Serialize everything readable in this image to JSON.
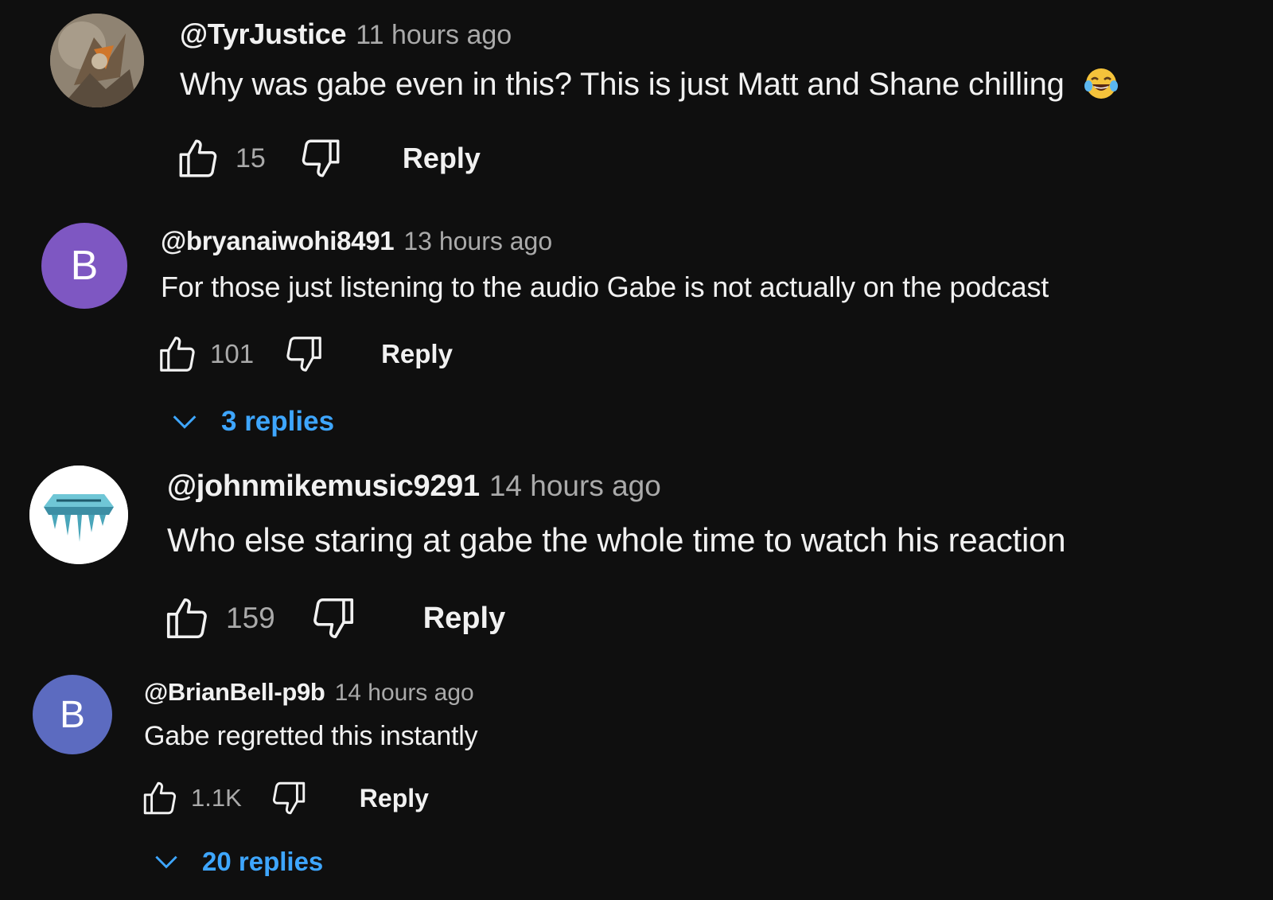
{
  "comments": [
    {
      "handle": "@TyrJustice",
      "time": "11 hours ago",
      "text": "Why was gabe even in this? This is just Matt and Shane chilling",
      "emoji": "face-with-tears-of-joy",
      "likes": "15",
      "reply_label": "Reply",
      "avatar": {
        "type": "image",
        "icon": "fantasy-creature-avatar"
      }
    },
    {
      "handle": "@bryanaiwohi8491",
      "time": "13 hours ago",
      "text": "For those just listening to the audio Gabe is not actually on the podcast",
      "likes": "101",
      "reply_label": "Reply",
      "avatar": {
        "type": "letter",
        "letter": "B",
        "color": "#7e57c2"
      },
      "replies_label": "3 replies"
    },
    {
      "handle": "@johnmikemusic9291",
      "time": "14 hours ago",
      "text": "Who else staring at gabe the whole time to watch his reaction",
      "likes": "159",
      "reply_label": "Reply",
      "avatar": {
        "type": "image",
        "icon": "icy-logo-avatar"
      }
    },
    {
      "handle": "@BrianBell-p9b",
      "time": "14 hours ago",
      "text": "Gabe regretted this instantly",
      "likes": "1.1K",
      "reply_label": "Reply",
      "avatar": {
        "type": "letter",
        "letter": "B",
        "color": "#5c6bc0"
      },
      "replies_label": "20 replies"
    }
  ],
  "colors": {
    "background": "#0f0f0f",
    "text": "#f1f1f1",
    "muted": "#aaaaaa",
    "link": "#3ea6ff"
  },
  "icons": [
    "thumbs-up-icon",
    "thumbs-down-icon",
    "chevron-down-icon"
  ]
}
